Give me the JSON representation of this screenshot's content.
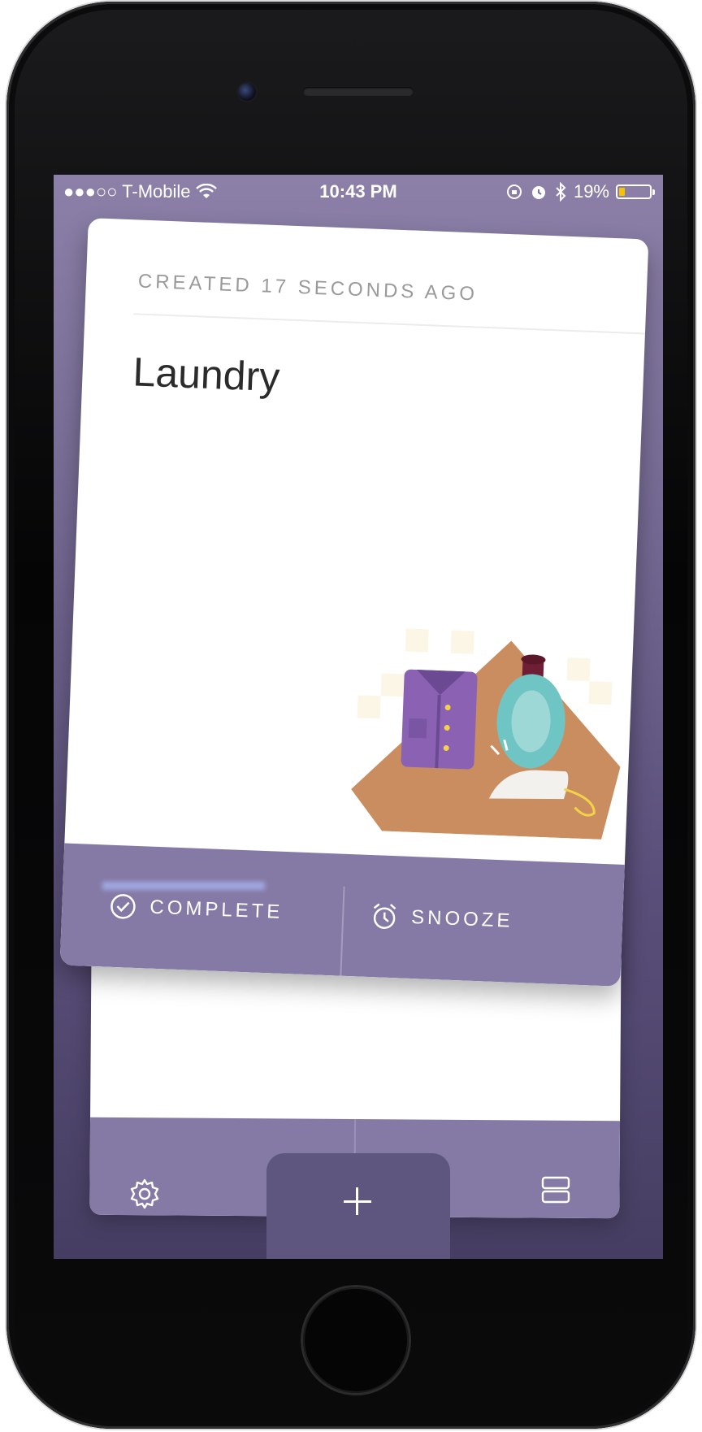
{
  "status_bar": {
    "carrier": "●●●○○ T-Mobile",
    "time": "10:43 PM",
    "battery_percent": "19%",
    "battery_level": 0.19,
    "battery_color": "#f5c400"
  },
  "card": {
    "created_label": "CREATED 17 SECONDS AGO",
    "title": "Laundry",
    "actions": {
      "complete_label": "COMPLETE",
      "snooze_label": "SNOOZE"
    }
  },
  "tab_bar": {
    "settings_icon": "gear-icon",
    "add_icon": "plus-icon",
    "stack_icon": "card-stack-icon"
  },
  "colors": {
    "background_top": "#8c80a8",
    "background_bottom": "#463e62",
    "action_bar": "#857aa5"
  }
}
